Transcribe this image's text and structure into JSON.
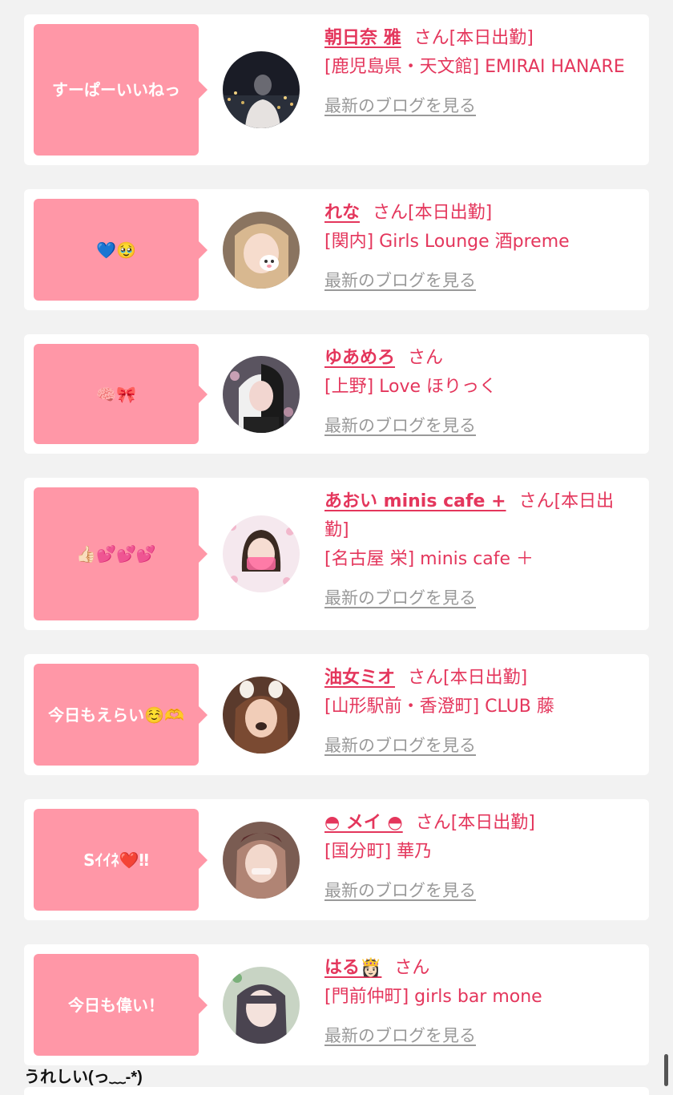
{
  "cards": [
    {
      "comment": "すーぱーいいねっ",
      "name": "朝日奈 雅",
      "suffix": "さん[本日出勤]",
      "shop": "[鹿児島県・天文館] EMIRAI HANARE",
      "blog": "最新のブログを見る"
    },
    {
      "comment": "💙🥹",
      "name": "れな",
      "suffix": "さん[本日出勤]",
      "shop": "[関内] Girls Lounge 酒preme",
      "blog": "最新のブログを見る"
    },
    {
      "comment": "🧠🎀",
      "name": "ゆあめろ",
      "suffix": "さん",
      "shop": "[上野] Love ほりっく",
      "blog": "最新のブログを見る"
    },
    {
      "comment": "👍🏻💕💕💕",
      "name": "あおい minis cafe +",
      "suffix": "さん[本日出勤]",
      "shop": "[名古屋 栄] minis cafe ＋",
      "blog": "最新のブログを見る"
    },
    {
      "comment": "今日もえらい☺️🫶",
      "name": "油女ミオ",
      "suffix": "さん[本日出勤]",
      "shop": "[山形駅前・香澄町] CLUB 藤",
      "blog": "最新のブログを見る"
    },
    {
      "comment": "Sｲｲﾈ❤️‼",
      "name": "◓ メイ ◓",
      "suffix": "さん[本日出勤]",
      "shop": "[国分町] 華乃",
      "blog": "最新のブログを見る"
    },
    {
      "comment": "今日も偉い！",
      "name": "はる👸🏻",
      "suffix": "さん",
      "shop": "[門前仲町] girls bar mone",
      "blog": "最新のブログを見る"
    }
  ],
  "footer_text": "うれしい(っ﹏-*)",
  "colors": {
    "bubble": "#ff97a7",
    "accent": "#e4365c",
    "link_gray": "#999999",
    "background": "#f2f2f2"
  },
  "avatar_icons": [
    "photo-avatar-icon"
  ]
}
